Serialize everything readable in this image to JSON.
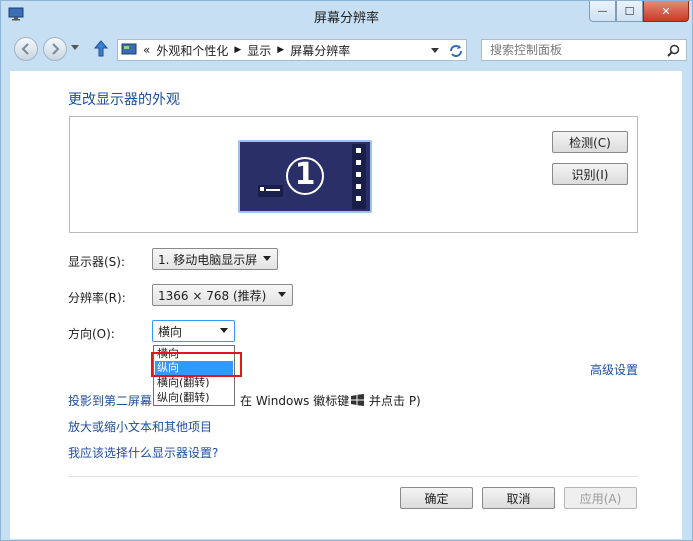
{
  "window": {
    "title": "屏幕分辨率",
    "minimize_label": "—",
    "maximize_label": "☐",
    "close_label": "✕"
  },
  "address_bar": {
    "root_marker": "«",
    "crumbs": [
      "外观和个性化",
      "显示",
      "屏幕分辨率"
    ],
    "search_placeholder": "搜索控制面板"
  },
  "page": {
    "title": "更改显示器的外观",
    "monitor_number": "1",
    "detect_button": "检测(C)",
    "identify_button": "识别(I)"
  },
  "settings": {
    "display_label": "显示器(S):",
    "display_value": "1. 移动电脑显示屏",
    "resolution_label": "分辨率(R):",
    "resolution_value": "1366 × 768 (推荐)",
    "orientation_label": "方向(O):",
    "orientation_value": "横向",
    "orientation_options": [
      "横向",
      "纵向",
      "横向(翻转)",
      "纵向(翻转)"
    ],
    "highlighted_option_index": 1
  },
  "links": {
    "advanced": "高级设置",
    "project": "投影到第二屏幕",
    "project_hint_prefix": "在 Windows 徽标键",
    "project_hint_suffix": "并点击 P)",
    "text_size": "放大或缩小文本和其他项目",
    "help": "我应该选择什么显示器设置?"
  },
  "footer": {
    "ok": "确定",
    "cancel": "取消",
    "apply": "应用(A)"
  },
  "colors": {
    "accent_link": "#1d4e9e",
    "highlight": "#3399ff",
    "annotation_red": "#e1151a",
    "window_frame": "#c7dff2"
  }
}
